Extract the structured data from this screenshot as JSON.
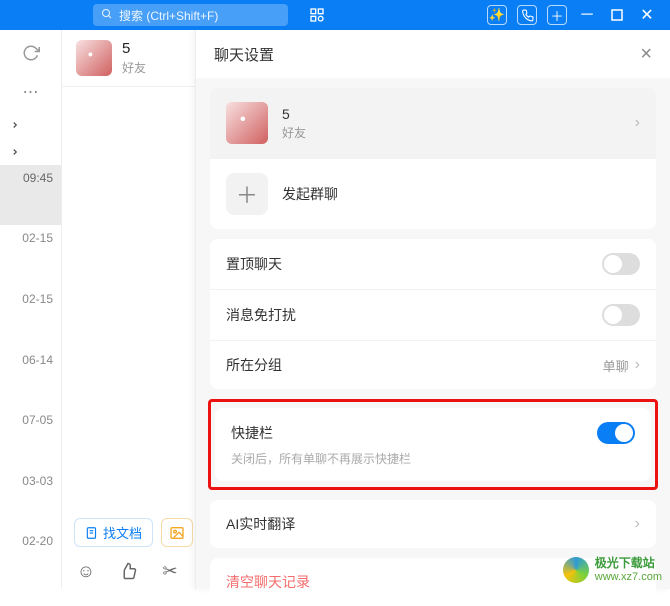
{
  "titlebar": {
    "search_placeholder": "搜索 (Ctrl+Shift+F)"
  },
  "sidebar": {
    "times": [
      "09:45",
      "02-15",
      "02-15",
      "06-14",
      "07-05",
      "03-03",
      "02-20"
    ]
  },
  "chat": {
    "name": "5",
    "sub": "好友",
    "find_doc": "找文档"
  },
  "panel": {
    "title": "聊天设置",
    "profile": {
      "name": "5",
      "sub": "好友"
    },
    "new_group": "发起群聊",
    "pin": "置顶聊天",
    "mute": "消息免打扰",
    "group_label": "所在分组",
    "group_value": "单聊",
    "quickbar": {
      "title": "快捷栏",
      "desc": "关闭后，所有单聊不再展示快捷栏"
    },
    "ai_translate": "AI实时翻译",
    "clear": "清空聊天记录"
  },
  "watermark": {
    "name": "极光下载站",
    "url": "www.xz7.com"
  }
}
